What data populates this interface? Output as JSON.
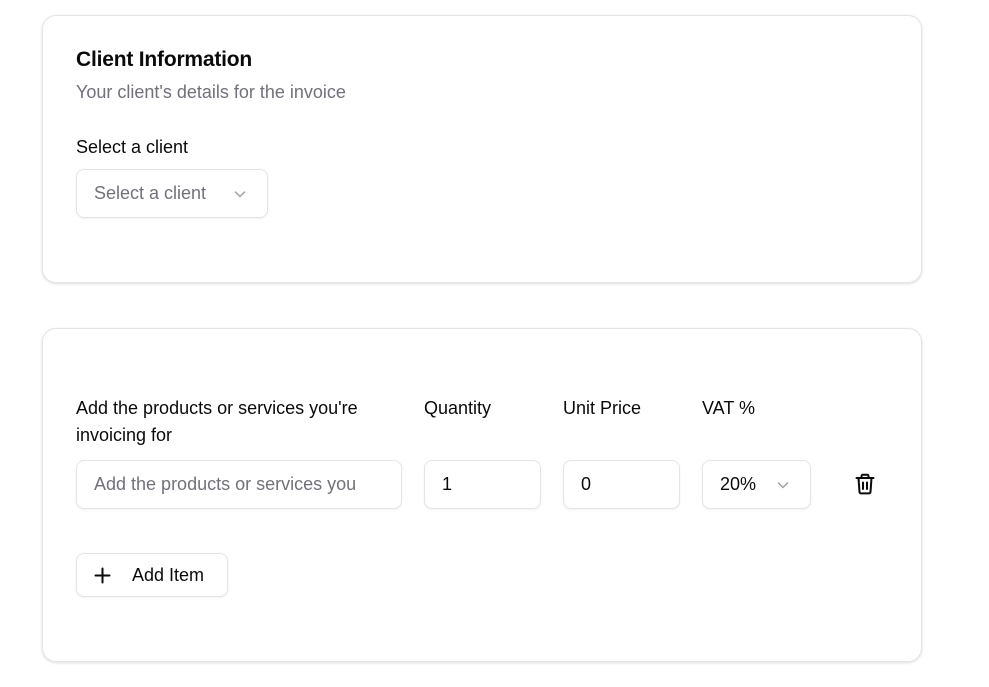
{
  "client_card": {
    "title": "Client Information",
    "description": "Your client's details for the invoice",
    "select_label": "Select a client",
    "select_placeholder": "Select a client"
  },
  "items_card": {
    "columns": {
      "description": "Add the products or services you're invoicing for",
      "quantity": "Quantity",
      "unit_price": "Unit Price",
      "vat": "VAT %"
    },
    "row": {
      "description_placeholder": "Add the products or services you",
      "quantity": "1",
      "unit_price": "0",
      "vat": "20%"
    },
    "add_item_label": "Add Item"
  },
  "icons": {
    "select_chevron": "chevron-down-icon",
    "vat_chevron": "chevron-down-icon",
    "delete": "trash-icon",
    "add": "plus-icon"
  },
  "colors": {
    "border": "#e4e4e7",
    "muted_text": "#71717a",
    "text": "#0a0a0a"
  }
}
